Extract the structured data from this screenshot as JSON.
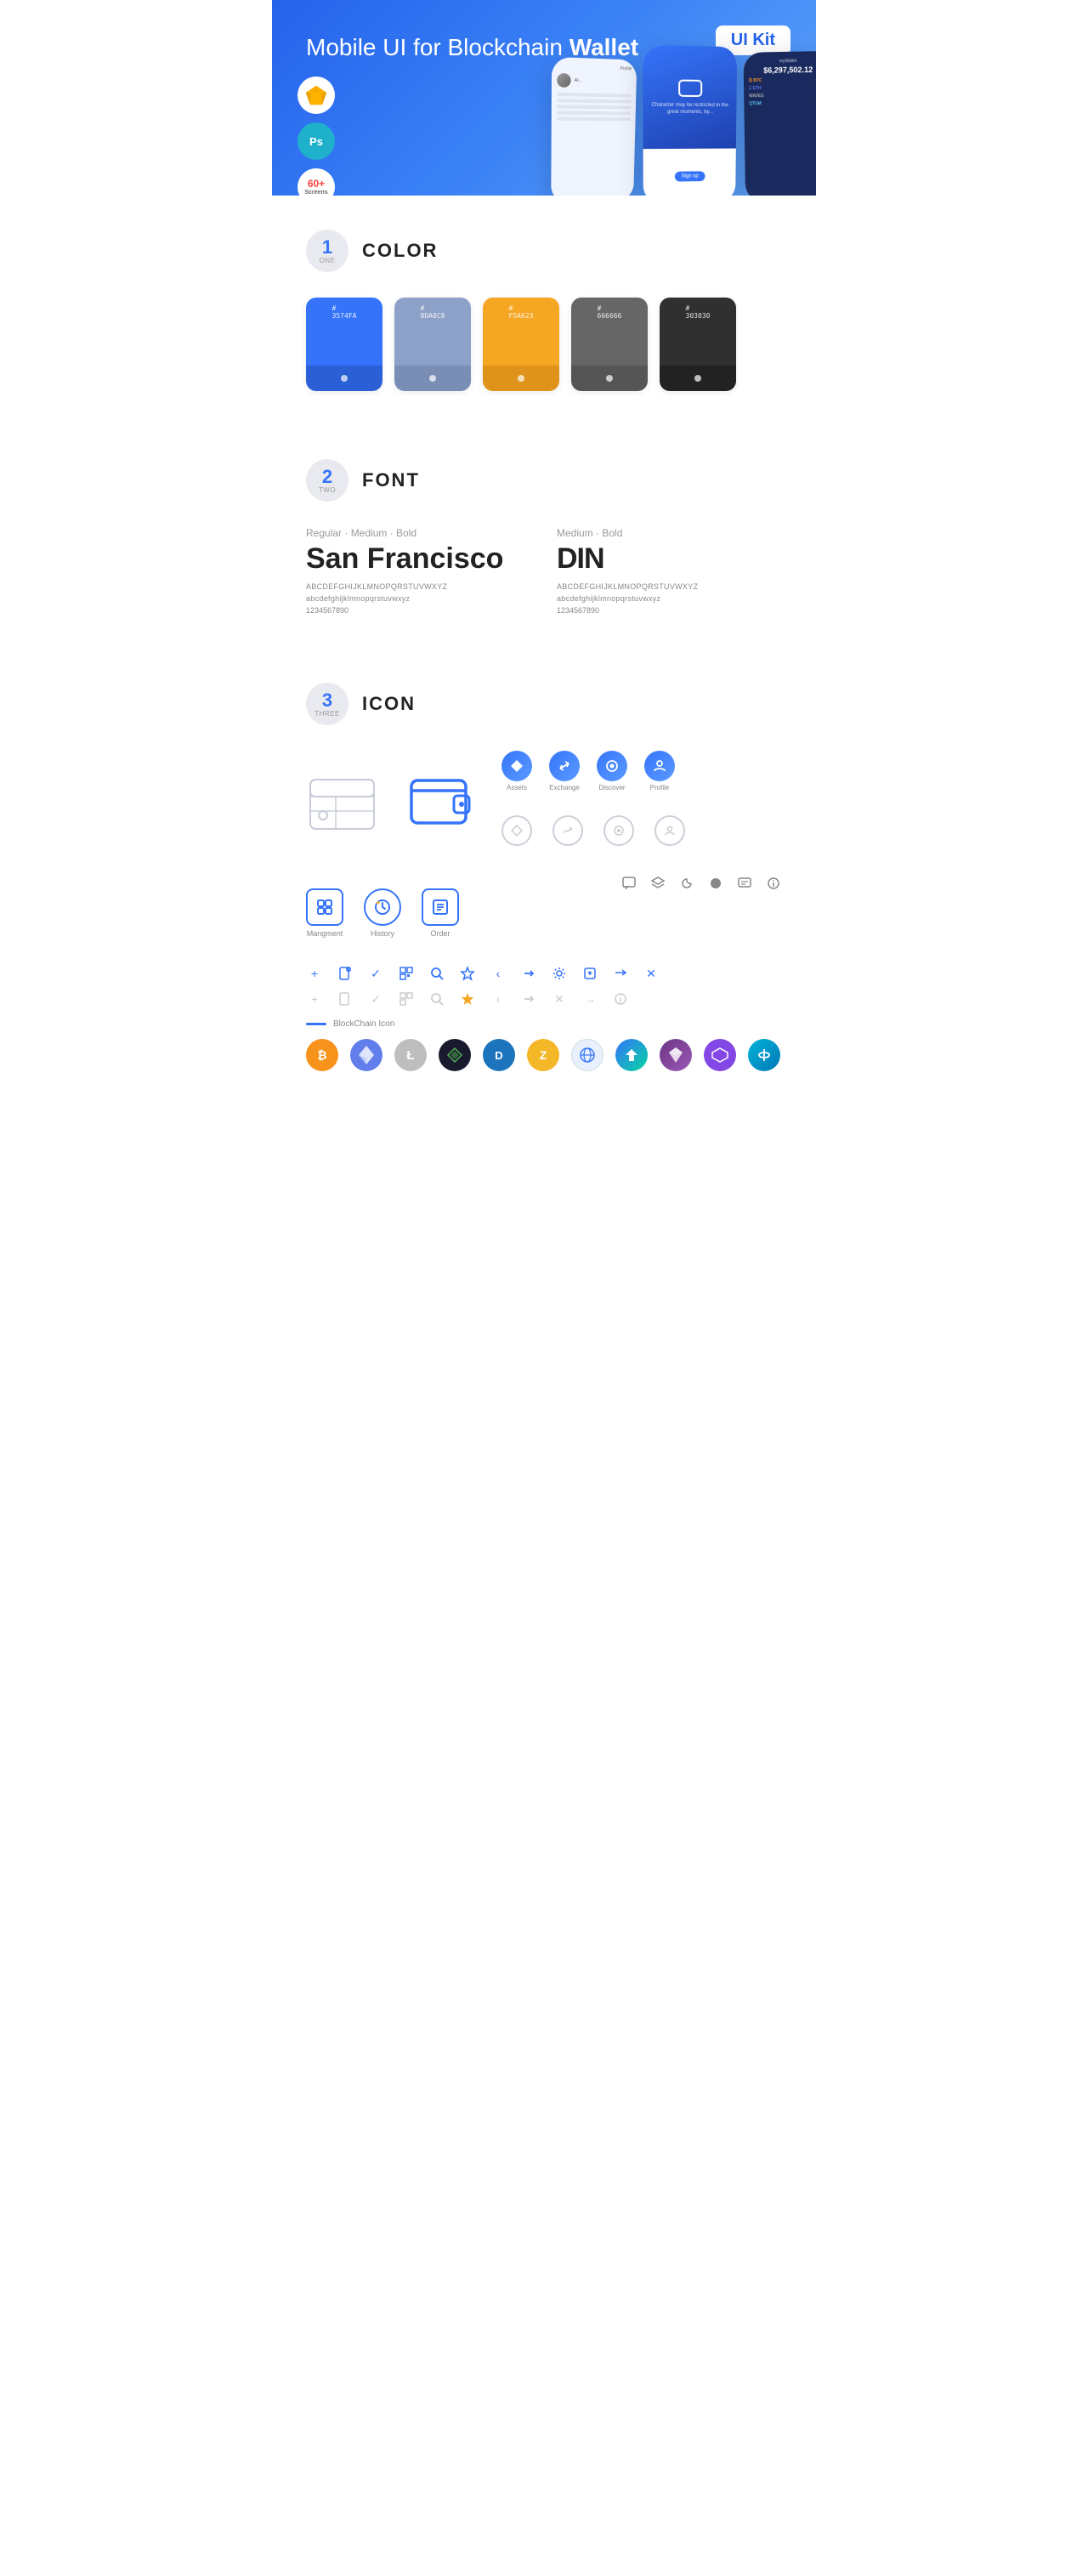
{
  "hero": {
    "title": "Mobile UI for Blockchain ",
    "title_bold": "Wallet",
    "badge": "UI Kit",
    "sketch_label": "Sketch",
    "ps_label": "Ps",
    "screens_label": "60+\nScreens"
  },
  "sections": {
    "color": {
      "number": "1",
      "number_word": "ONE",
      "title": "COLOR",
      "swatches": [
        {
          "hex": "#3574FA",
          "label": "3574FA"
        },
        {
          "hex": "#8DA0C8",
          "label": "8DA0C8"
        },
        {
          "hex": "#F5A623",
          "label": "F5A623"
        },
        {
          "hex": "#666666",
          "label": "666666"
        },
        {
          "hex": "#303030",
          "label": "303030"
        }
      ]
    },
    "font": {
      "number": "2",
      "number_word": "TWO",
      "title": "FONT",
      "font1": {
        "weight_label": "Regular · Medium · Bold",
        "name": "San Francisco",
        "uppercase": "ABCDEFGHIJKLMNOPQRSTUVWXYZ",
        "lowercase": "abcdefghijklmnopqrstuvwxyz",
        "numbers": "1234567890"
      },
      "font2": {
        "weight_label": "Medium · Bold",
        "name": "DIN",
        "uppercase": "ABCDEFGHIJKLMNOPQRSTUVWXYZ",
        "lowercase": "abcdefghijklmnopqrstuvwxyz",
        "numbers": "1234567890"
      }
    },
    "icon": {
      "number": "3",
      "number_word": "THREE",
      "title": "ICON",
      "nav_labels": [
        "Assets",
        "Exchange",
        "Discover",
        "Profile"
      ],
      "mgmt_labels": [
        "Mangment",
        "History",
        "Order"
      ],
      "blockchain_label": "BlockChain Icon"
    }
  }
}
